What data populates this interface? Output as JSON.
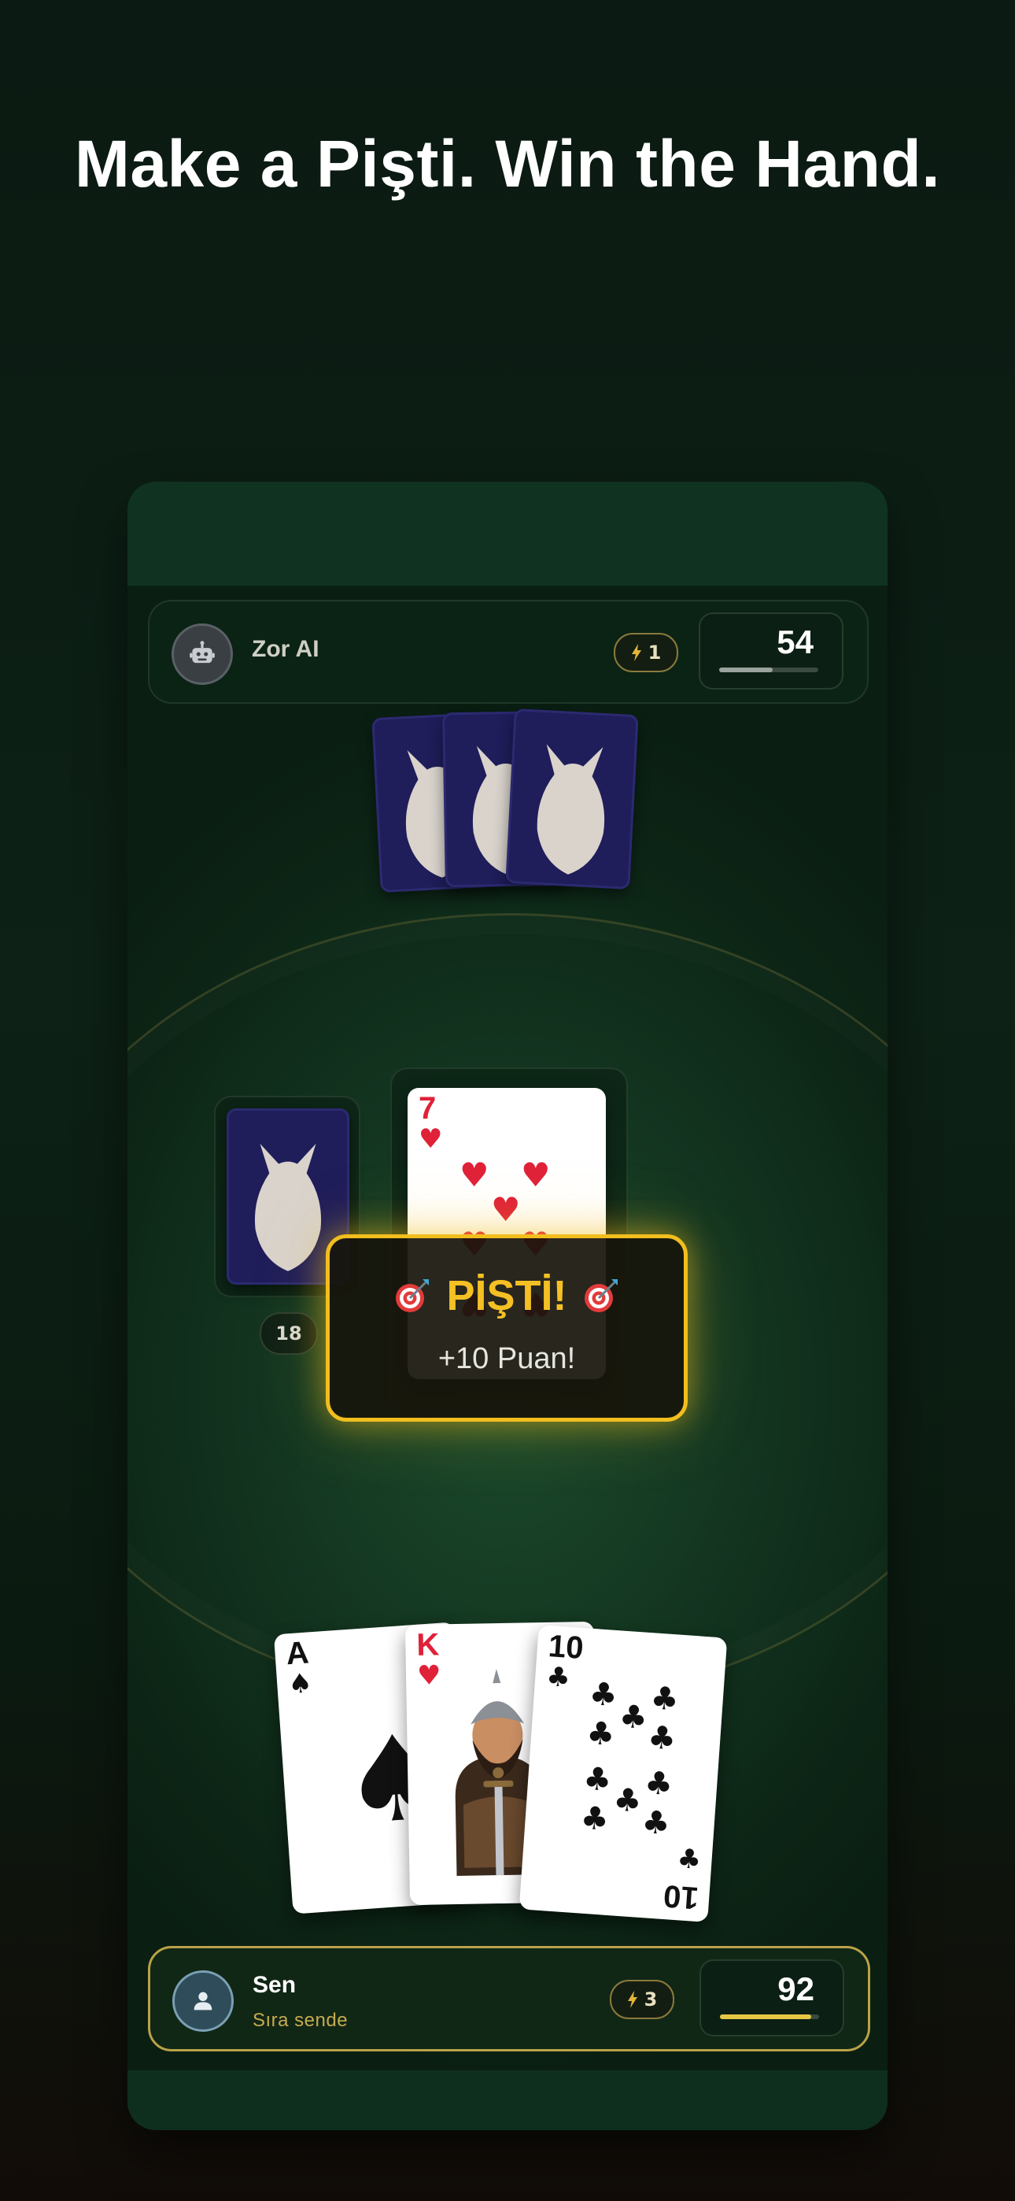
{
  "headline": "Make a Pişti. Win the Hand.",
  "opponent": {
    "name": "Zor AI",
    "icon": "robot-icon",
    "bolt_count": "1",
    "score": "54",
    "score_progress": 0.54,
    "hand_cards": 3
  },
  "table": {
    "pile_count": "18",
    "top_card": {
      "rank": "7",
      "suit": "hearts"
    }
  },
  "pisti_popup": {
    "title": "PİŞTİ!",
    "points": "+10 Puan!",
    "icon": "target-icon"
  },
  "player": {
    "name": "Sen",
    "status": "Sıra sende",
    "icon": "user-icon",
    "bolt_count": "3",
    "score": "92",
    "score_progress": 0.92,
    "hand": [
      {
        "rank": "A",
        "suit": "spades"
      },
      {
        "rank": "K",
        "suit": "hearts"
      },
      {
        "rank": "10",
        "suit": "clubs"
      }
    ]
  },
  "colors": {
    "accent_gold": "#f2be1e",
    "card_back": "#1f1d5a",
    "heart_red": "#e02239"
  }
}
